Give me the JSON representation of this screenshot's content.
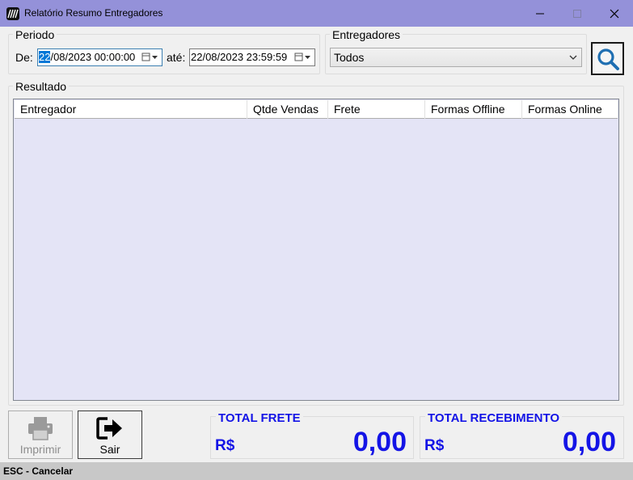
{
  "window": {
    "title": "Relatório Resumo Entregadores",
    "minimize_glyph": "—",
    "maximize_glyph": "☐",
    "close_glyph": "✕"
  },
  "periodo": {
    "label": "Periodo",
    "de_label": "De:",
    "de_selected": "22",
    "de_rest": "/08/2023 00:00:00",
    "ate_label": "até:",
    "ate_value": "22/08/2023 23:59:59"
  },
  "entregadores": {
    "label": "Entregadores",
    "selected": "Todos"
  },
  "resultado": {
    "label": "Resultado",
    "columns": [
      "Entregador",
      "Qtde Vendas",
      "Frete",
      "Formas Offline",
      "Formas Online"
    ]
  },
  "buttons": {
    "imprimir": "Imprimir",
    "sair": "Sair"
  },
  "totals": {
    "frete_title": "TOTAL FRETE",
    "frete_currency": "R$",
    "frete_value": "0,00",
    "recebimento_title": "TOTAL RECEBIMENTO",
    "recebimento_currency": "R$",
    "recebimento_value": "0,00"
  },
  "status": {
    "text": "ESC - Cancelar"
  },
  "colors": {
    "titlebar": "#9491d9",
    "accent_total": "#1414e6",
    "grid_background": "#e4e4f6",
    "search_icon": "#1f6fb2"
  },
  "icons": [
    "app-icon",
    "calendar-dropdown-icon",
    "chevron-down-icon",
    "search-icon",
    "printer-icon",
    "exit-arrow-icon"
  ]
}
